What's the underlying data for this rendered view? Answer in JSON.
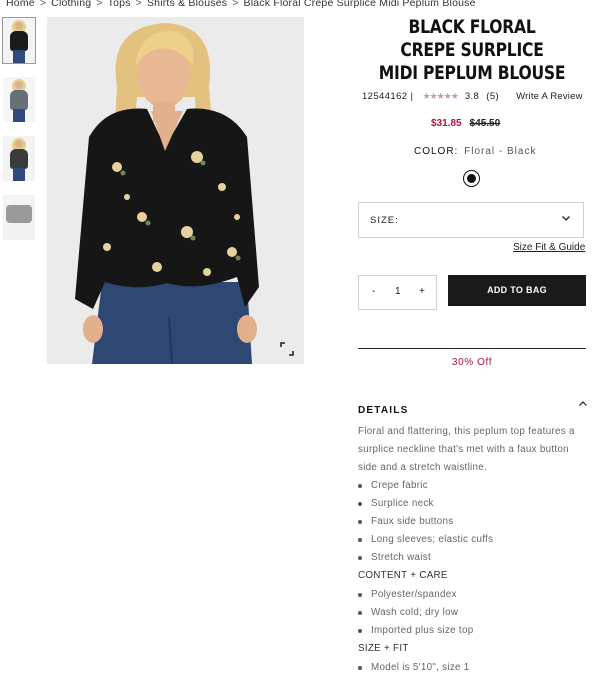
{
  "breadcrumb": [
    "Home",
    "Clothing",
    "Tops",
    "Shirts & Blouses",
    "Black Floral Crepe Surplice Midi Peplum Blouse"
  ],
  "breadcrumb_separator": ">",
  "product": {
    "title": "BLACK FLORAL CREPE SURPLICE MIDI PEPLUM BLOUSE",
    "sku": "12544162",
    "sku_separator": "|",
    "stars": "★★★★★",
    "rating": "3.8",
    "review_count": "(5)",
    "write_review": "Write A Review",
    "price_sale": "$31.85",
    "price_original": "$45.50",
    "color_label": "COLOR:",
    "color_value": "Floral - Black",
    "swatch_color": "#111111"
  },
  "size": {
    "label": "SIZE:",
    "guide": "Size Fit & Guide"
  },
  "quantity": {
    "minus": "-",
    "value": "1",
    "plus": "+"
  },
  "add_to_bag": "ADD TO BAG",
  "promo": "30% Off",
  "details": {
    "heading": "DETAILS",
    "description": "Floral and flattering, this peplum top features a surplice neckline that's met with a faux button side and a stretch waistline.",
    "features": [
      "Crepe fabric",
      "Surplice neck",
      "Faux side buttons",
      "Long sleeves; elastic cuffs",
      "Stretch waist"
    ],
    "content_heading": "CONTENT + CARE",
    "content": [
      "Polyester/spandex",
      "Wash cold; dry low",
      "Imported plus size top"
    ],
    "fit_heading": "SIZE + FIT",
    "fit": [
      "Model is 5'10\", size 1"
    ]
  },
  "colors": {
    "accent": "#b0123a",
    "button": "#1a1a1a"
  }
}
